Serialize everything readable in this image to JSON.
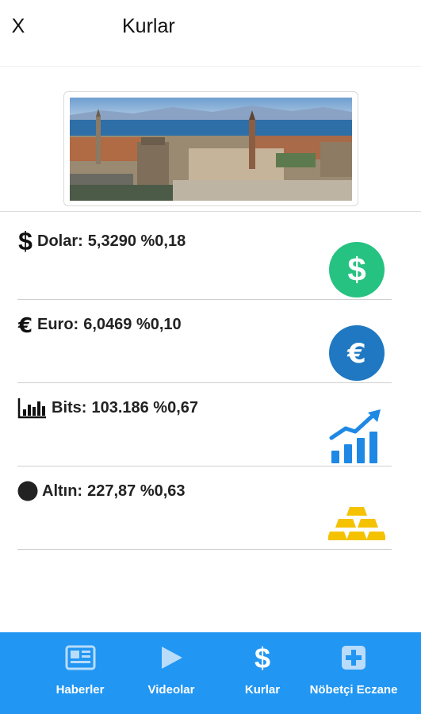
{
  "header": {
    "close_label": "X",
    "title": "Kurlar"
  },
  "banner": {
    "alt_icon": "city-panorama-image"
  },
  "rates": [
    {
      "lead_icon": "dollar-sign-icon",
      "name": "Dolar:",
      "value": "5,3290 %0,18",
      "badge_icon": "dollar-circle-icon",
      "badge_color": "#26c281"
    },
    {
      "lead_icon": "euro-sign-icon",
      "name": "Euro:",
      "value": "6,0469 %0,10",
      "badge_icon": "euro-circle-icon",
      "badge_color": "#1f78c1"
    },
    {
      "lead_icon": "bar-chart-icon",
      "name": "Bits:",
      "value": "103.186 %0,67",
      "badge_icon": "growth-chart-icon",
      "badge_color": "#1e88e5"
    },
    {
      "lead_icon": "circle-icon",
      "name": "Altın:",
      "value": "227,87 %0,63",
      "badge_icon": "gold-bars-icon",
      "badge_color": "#f5c200"
    }
  ],
  "nav": {
    "background": "#2196f3",
    "items": [
      {
        "label": "Haberler",
        "icon": "newspaper-icon"
      },
      {
        "label": "Videolar",
        "icon": "play-icon"
      },
      {
        "label": "Kurlar",
        "icon": "dollar-icon"
      },
      {
        "label": "Nöbetçi Eczane",
        "icon": "pharmacy-plus-icon"
      }
    ]
  }
}
